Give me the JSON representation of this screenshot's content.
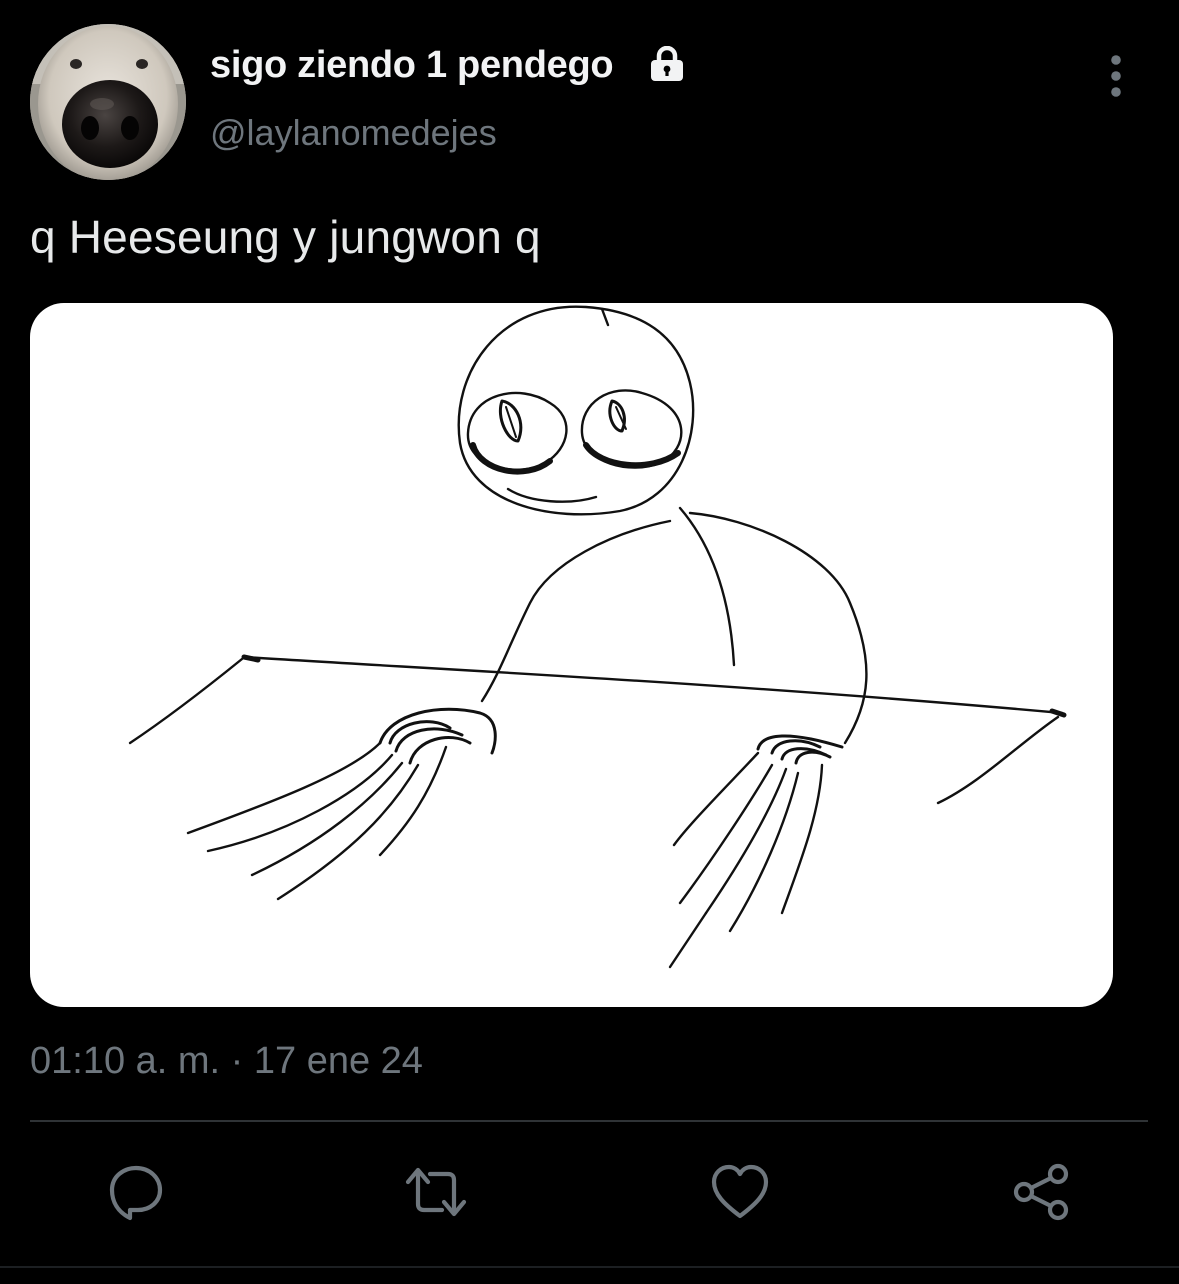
{
  "user": {
    "display_name": "sigo ziendo 1 pendego",
    "handle": "@laylanomedejes",
    "protected_icon": "lock-icon",
    "avatar_icon": "dog-nose-photo"
  },
  "tweet": {
    "text": "q Heeseung y jungwon q",
    "timestamp": "01:10 a. m. · 17 ene 24",
    "media_icon": "stick-figure-drawing"
  },
  "actions": {
    "more_icon": "more-vertical-icon",
    "reply_icon": "reply-icon",
    "retweet_icon": "retweet-icon",
    "like_icon": "heart-icon",
    "share_icon": "share-icon"
  },
  "colors": {
    "background": "#000000",
    "primary_text": "#e7e9ea",
    "secondary_text": "#6e767d",
    "divider": "#2f3336",
    "icon": "#6e767d"
  }
}
